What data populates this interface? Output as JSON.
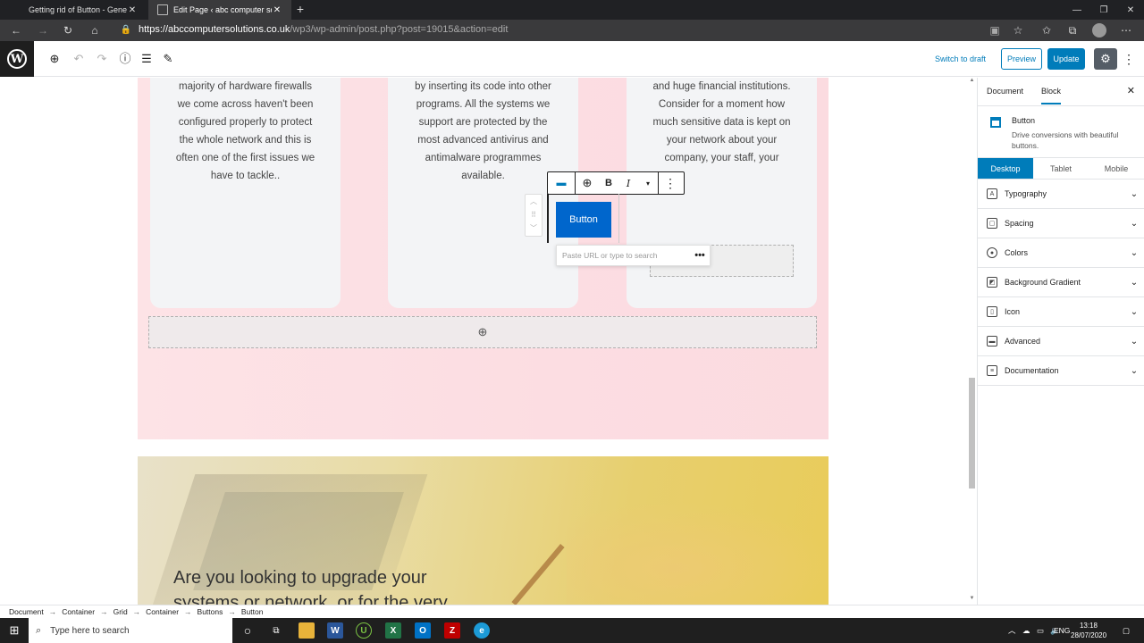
{
  "browser": {
    "tabs": [
      {
        "title": "Getting rid of Button - Generate"
      },
      {
        "title": "Edit Page ‹ abc computer solutio"
      }
    ],
    "url_main": "https://abccomputersolutions.co.uk",
    "url_path": "/wp3/wp-admin/post.php?post=19015&action=edit"
  },
  "toolbar": {
    "switch_to_draft": "Switch to draft",
    "preview": "Preview",
    "update": "Update"
  },
  "content": {
    "card1_lines": [
      "majority of hardware firewalls",
      "we come across haven't been",
      "configured properly to protect",
      "the whole network and this is",
      "often one of the first issues we",
      "have to tackle.."
    ],
    "card2_lines": [
      "by inserting its code into other",
      "programs. All the systems we",
      "support are protected by the",
      "most advanced antivirus and",
      "antimalware programmes",
      "available."
    ],
    "card3_lines": [
      "and huge financial institutions.",
      "Consider for a moment how",
      "much sensitive data is kept on",
      "your network about your",
      "company, your staff, your"
    ],
    "button_label": "Button",
    "url_placeholder": "Paste URL or type to search",
    "hero_heading_1": "Are you looking to upgrade your",
    "hero_heading_2": "systems or network, or for the very"
  },
  "sidebar": {
    "tabs": [
      "Document",
      "Block"
    ],
    "block_name": "Button",
    "block_desc": "Drive conversions with beautiful buttons.",
    "devices": [
      "Desktop",
      "Tablet",
      "Mobile"
    ],
    "panels": [
      "Typography",
      "Spacing",
      "Colors",
      "Background Gradient",
      "Icon",
      "Advanced",
      "Documentation"
    ]
  },
  "breadcrumb": [
    "Document",
    "Container",
    "Grid",
    "Container",
    "Buttons",
    "Button"
  ],
  "taskbar": {
    "search_placeholder": "Type here to search",
    "language": "ENG",
    "time": "13:18",
    "date": "28/07/2020"
  },
  "colors": {
    "wp_blue": "#007cba",
    "button_blue": "#0066cc",
    "pink_bg": "#fde3e6"
  }
}
